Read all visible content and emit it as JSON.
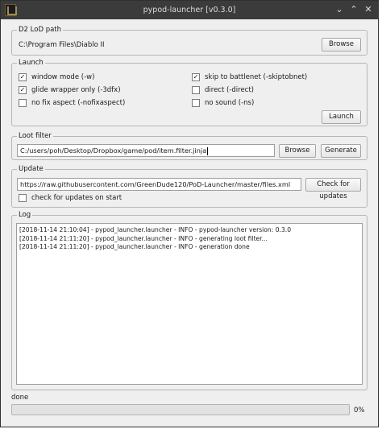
{
  "window": {
    "title": "pypod-launcher [v0.3.0]",
    "minimize_glyph": "⌄",
    "maximize_glyph": "⌃",
    "close_glyph": "✕"
  },
  "d2_path": {
    "legend": "D2 LoD path",
    "value": "C:\\Program Files\\Diablo II",
    "browse_label": "Browse"
  },
  "launch": {
    "legend": "Launch",
    "options": [
      {
        "label": "window mode (-w)",
        "checked": true
      },
      {
        "label": "glide wrapper only (-3dfx)",
        "checked": true
      },
      {
        "label": "no fix aspect (-nofixaspect)",
        "checked": false
      },
      {
        "label": "skip to battlenet (-skiptobnet)",
        "checked": true
      },
      {
        "label": "direct (-direct)",
        "checked": false
      },
      {
        "label": "no sound (-ns)",
        "checked": false
      }
    ],
    "launch_label": "Launch"
  },
  "loot_filter": {
    "legend": "Loot filter",
    "path": "C:/users/poh/Desktop/Dropbox/game/pod/item.filter.jinja",
    "browse_label": "Browse",
    "generate_label": "Generate"
  },
  "update": {
    "legend": "Update",
    "url": "https://raw.githubusercontent.com/GreenDude120/PoD-Launcher/master/files.xml",
    "check_label": "Check for updates",
    "on_start_label": "check for updates on start",
    "on_start_checked": false
  },
  "log": {
    "legend": "Log",
    "lines": [
      "[2018-11-14 21:10:04] - pypod_launcher.launcher - INFO - pypod-launcher version: 0.3.0",
      "[2018-11-14 21:11:20] - pypod_launcher.launcher - INFO - generating loot filter...",
      "[2018-11-14 21:11:20] - pypod_launcher.launcher - INFO - generation done"
    ]
  },
  "status": {
    "text": "done",
    "progress_percent": 0,
    "progress_label": "0%"
  },
  "colors": {
    "titlebar": "#3b3b3b",
    "window_bg": "#efefef",
    "progress_fill": "#5a8ec8"
  }
}
